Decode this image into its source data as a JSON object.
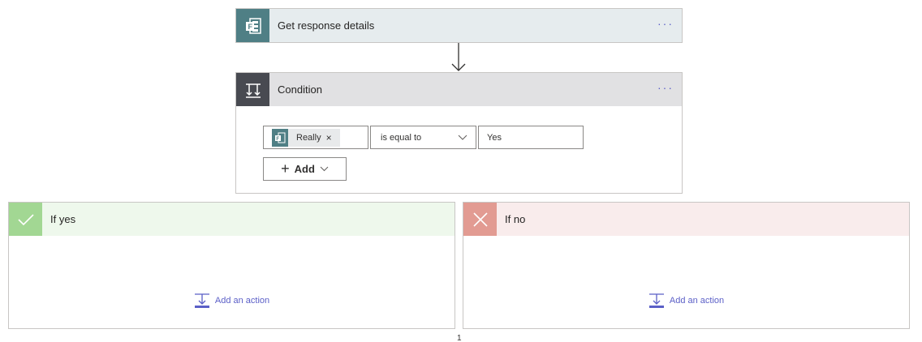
{
  "steps": {
    "response": {
      "title": "Get response details",
      "menu": "···",
      "icon": "forms-icon"
    },
    "condition": {
      "title": "Condition",
      "menu": "···",
      "icon": "condition-icon",
      "token_label": "Really",
      "token_remove": "×",
      "operator": "is equal to",
      "value": "Yes",
      "add_label": "Add"
    }
  },
  "branches": {
    "yes": {
      "title": "If yes",
      "add_action": "Add an action"
    },
    "no": {
      "title": "If no",
      "add_action": "Add an action"
    }
  },
  "footer": {
    "mark": "1"
  },
  "colors": {
    "response_header": "#e6ecee",
    "response_icon_bg": "#4f7f85",
    "condition_header": "#e1e1e3",
    "condition_icon_bg": "#484a51",
    "yes_header": "#eef8ec",
    "yes_icon_bg": "#a2d793",
    "no_header": "#f9ecec",
    "no_icon_bg": "#e29b92",
    "link": "#5b5fc7"
  }
}
